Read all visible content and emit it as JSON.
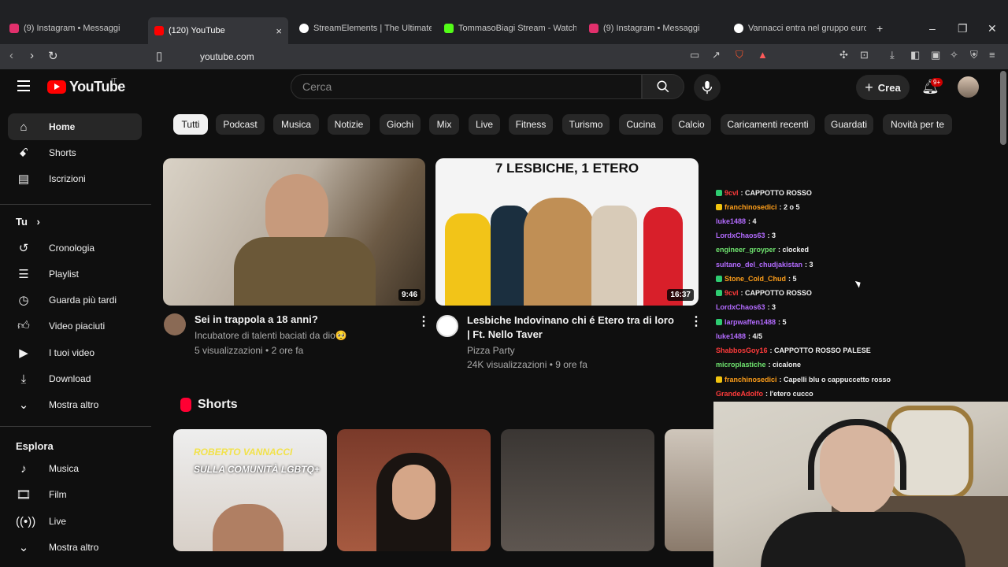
{
  "browser": {
    "tabs": [
      {
        "title": "(9) Instagram • Messaggi",
        "active": false,
        "color": "#e1306c"
      },
      {
        "title": "(120) YouTube",
        "active": true,
        "color": "#ff0000"
      },
      {
        "title": "StreamElements | The Ultimate S",
        "active": false,
        "color": "#ffffff"
      },
      {
        "title": "TommasoBiagi Stream - Watch L",
        "active": false,
        "color": "#53fc18"
      },
      {
        "title": "(9) Instagram • Messaggi",
        "active": false,
        "color": "#e1306c"
      },
      {
        "title": "Vannacci entra nel gruppo euro",
        "active": false,
        "color": "#ffffff"
      }
    ],
    "url": "youtube.com",
    "close_glyph": "×",
    "new_tab_glyph": "+"
  },
  "header": {
    "logo_text": "YouTube",
    "country": "IT",
    "search_placeholder": "Cerca",
    "create_label": "Crea",
    "notifications": "9+"
  },
  "sidebar": {
    "main": [
      {
        "label": "Home",
        "icon": "home-icon",
        "active": true
      },
      {
        "label": "Shorts",
        "icon": "shorts-icon"
      },
      {
        "label": "Iscrizioni",
        "icon": "subscriptions-icon"
      }
    ],
    "you_title": "Tu",
    "you": [
      {
        "label": "Cronologia",
        "icon": "history-icon"
      },
      {
        "label": "Playlist",
        "icon": "playlist-icon"
      },
      {
        "label": "Guarda più tardi",
        "icon": "watch-later-icon"
      },
      {
        "label": "Video piaciuti",
        "icon": "like-icon"
      },
      {
        "label": "I tuoi video",
        "icon": "your-videos-icon"
      },
      {
        "label": "Download",
        "icon": "download-icon"
      },
      {
        "label": "Mostra altro",
        "icon": "chevron-down-icon"
      }
    ],
    "explore_title": "Esplora",
    "explore": [
      {
        "label": "Musica",
        "icon": "music-icon"
      },
      {
        "label": "Film",
        "icon": "film-icon"
      },
      {
        "label": "Live",
        "icon": "live-icon"
      },
      {
        "label": "Mostra altro",
        "icon": "chevron-down-icon"
      }
    ]
  },
  "chips": [
    "Tutti",
    "Podcast",
    "Musica",
    "Notizie",
    "Giochi",
    "Mix",
    "Live",
    "Fitness",
    "Turismo",
    "Cucina",
    "Calcio",
    "Caricamenti recenti",
    "Guardati",
    "Novità per te"
  ],
  "videos": [
    {
      "title": "Sei in trappola a 18 anni?",
      "channel": "Incubatore di talenti baciati da dio🥺",
      "meta": "5 visualizzazioni • 2 ore fa",
      "duration": "9:46"
    },
    {
      "title": "Lesbiche Indovinano chi é Etero tra di loro | Ft. Nello Taver",
      "channel": "Pizza Party",
      "meta": "24K visualizzazioni • 9 ore fa",
      "duration": "16:37",
      "thumb_text": "7 LESBICHE, 1 ETERO"
    }
  ],
  "shorts_title": "Shorts",
  "shorts": [
    {
      "line1": "ROBERTO VANNACCI",
      "line2": "SULLA COMUNITÀ LGBTQ+"
    },
    {},
    {},
    {}
  ],
  "chat": [
    {
      "user": "9cvl",
      "msg": ": CAPPOTTO ROSSO",
      "color": "#ff3b3b",
      "badge": "#2ecc71"
    },
    {
      "user": "franchinosedici",
      "msg": ": 2 o 5",
      "color": "#ff9f1a",
      "badge": "#f1c40f"
    },
    {
      "user": "luke1488",
      "msg": ": 4",
      "color": "#b36bff"
    },
    {
      "user": "LordxChaos63",
      "msg": ": 3",
      "color": "#b36bff"
    },
    {
      "user": "engineer_groyper",
      "msg": ": clocked",
      "color": "#6fe36f"
    },
    {
      "user": "sultano_del_chudjakistan",
      "msg": ": 3",
      "color": "#b36bff"
    },
    {
      "user": "Stone_Cold_Chud",
      "msg": ": 5",
      "color": "#ff9f1a",
      "badge": "#2ecc71"
    },
    {
      "user": "9cvl",
      "msg": ": CAPPOTTO ROSSO",
      "color": "#ff3b3b",
      "badge": "#2ecc71"
    },
    {
      "user": "LordxChaos63",
      "msg": ": 3",
      "color": "#b36bff"
    },
    {
      "user": "larpwaffen1488",
      "msg": ": 5",
      "color": "#b36bff",
      "badge": "#2ecc71"
    },
    {
      "user": "luke1488",
      "msg": ": 4/5",
      "color": "#b36bff"
    },
    {
      "user": "ShabbosGoy16",
      "msg": ": CAPPOTTO ROSSO PALESE",
      "color": "#ff3b3b"
    },
    {
      "user": "microplastiche",
      "msg": ": cicalone",
      "color": "#6fe36f"
    },
    {
      "user": "franchinosedici",
      "msg": ": Capelli blu o cappuccetto rosso",
      "color": "#ff9f1a",
      "badge": "#f1c40f"
    },
    {
      "user": "GrandeAdolfo",
      "msg": ": l'etero cucco",
      "color": "#ff3b3b"
    }
  ]
}
